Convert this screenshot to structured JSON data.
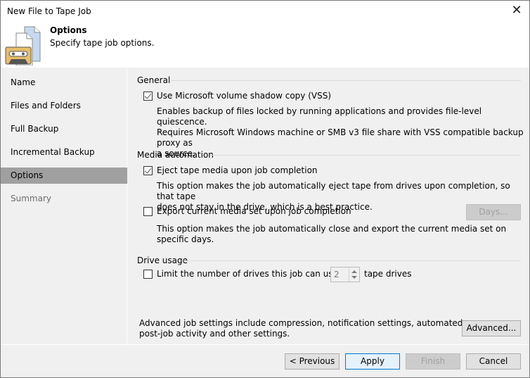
{
  "window": {
    "title": "New File to Tape Job",
    "close_icon": "close-icon"
  },
  "header": {
    "title": "Options",
    "subtitle": "Specify tape job options.",
    "icon": "tape-files-icon"
  },
  "sidebar": {
    "items": [
      {
        "label": "Name",
        "state": "normal"
      },
      {
        "label": "Files and Folders",
        "state": "normal"
      },
      {
        "label": "Full Backup",
        "state": "normal"
      },
      {
        "label": "Incremental Backup",
        "state": "normal"
      },
      {
        "label": "Options",
        "state": "active"
      },
      {
        "label": "Summary",
        "state": "disabled"
      }
    ]
  },
  "general": {
    "label": "General",
    "vss": {
      "label": "Use Microsoft volume shadow copy (VSS)",
      "checked": true,
      "desc_lines": [
        "Enables backup of files locked by running applications and provides file-level quiescence.",
        "Requires Microsoft Windows machine or SMB v3 file share with VSS compatible backup proxy as",
        "a source."
      ]
    }
  },
  "media": {
    "label": "Media automation",
    "eject": {
      "label": "Eject tape media upon job completion",
      "checked": true,
      "desc_lines": [
        "This option makes the job automatically eject tape from drives upon completion, so that tape",
        "does not stay in the drive, which is a best practice."
      ]
    },
    "export": {
      "label": "Export current media set upon job completion",
      "checked": false,
      "days_button": "Days...",
      "desc": "This option makes the job automatically close and export the current media set on specific days."
    }
  },
  "drives": {
    "label": "Drive usage",
    "limit_label": "Limit the number of drives this job can use to:",
    "checked": false,
    "value": "2",
    "suffix": "tape drives"
  },
  "advanced": {
    "desc_lines": [
      "Advanced job settings include compression, notification settings, automated",
      "post-job activity and other settings."
    ],
    "button": "Advanced..."
  },
  "footer": {
    "previous": "< Previous",
    "apply": "Apply",
    "finish": "Finish",
    "cancel": "Cancel"
  }
}
